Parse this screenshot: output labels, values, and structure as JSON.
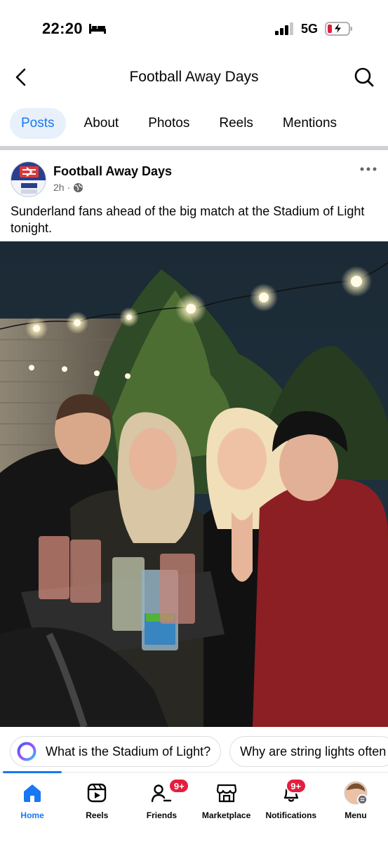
{
  "status_bar": {
    "time": "22:20",
    "network": "5G",
    "icons": [
      "bed-icon",
      "signal-icon",
      "battery-charging-icon"
    ],
    "battery_color": "#e41e3f"
  },
  "header": {
    "title": "Football Away Days",
    "icons": [
      "back-arrow-icon",
      "search-icon"
    ]
  },
  "tabs": [
    {
      "label": "Posts",
      "active": true
    },
    {
      "label": "About",
      "active": false
    },
    {
      "label": "Photos",
      "active": false
    },
    {
      "label": "Reels",
      "active": false
    },
    {
      "label": "Mentions",
      "active": false
    }
  ],
  "post": {
    "author": "Football Away Days",
    "time": "2h",
    "separator": "·",
    "privacy_icon": "globe-icon",
    "text": "Sunderland fans ahead of the big match at the Stadium of Light tonight.",
    "more_icon": "more-options-icon"
  },
  "chips": [
    {
      "label": "What is the Stadium of Light?",
      "icon": "meta-ai-icon"
    },
    {
      "label": "Why are string lights often"
    }
  ],
  "bottom_nav": [
    {
      "label": "Home",
      "icon": "home-icon",
      "active": true
    },
    {
      "label": "Reels",
      "icon": "reels-icon"
    },
    {
      "label": "Friends",
      "icon": "friends-icon",
      "badge": "9+"
    },
    {
      "label": "Marketplace",
      "icon": "marketplace-icon"
    },
    {
      "label": "Notifications",
      "icon": "bell-icon",
      "badge": "9+"
    },
    {
      "label": "Menu",
      "icon": "profile-avatar-icon"
    }
  ],
  "colors": {
    "accent": "#1877f2",
    "tab_active_bg": "#e7f0fb",
    "badge": "#e41e3f",
    "meta_text": "#65676b"
  }
}
